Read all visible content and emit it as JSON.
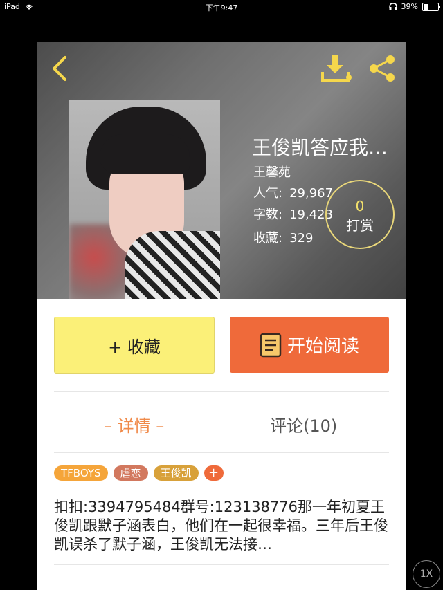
{
  "status_bar": {
    "device": "iPad",
    "time": "下午9:47",
    "battery": "39%"
  },
  "book": {
    "title": "王俊凯答应我…",
    "author": "王馨苑",
    "stats": [
      {
        "label": "人气:",
        "value": "29,967"
      },
      {
        "label": "字数:",
        "value": "19,423"
      },
      {
        "label": "收藏:",
        "value": "329"
      }
    ],
    "tip": {
      "count": "0",
      "label": "打赏"
    }
  },
  "buttons": {
    "favorite": "+ 收藏",
    "read": "开始阅读"
  },
  "tabs": {
    "details": "– 详情 –",
    "comments": "评论(10)"
  },
  "tags": [
    "TFBOYS",
    "虐恋",
    "王俊凯",
    "+"
  ],
  "description": "扣扣:3394795484群号:123138776那一年初夏王俊凯跟默子涵表白，他们在一起很幸福。三年后王俊凯误杀了默子涵，王俊凯无法接…",
  "speed": "1X",
  "icons": {
    "back": "back-arrow-icon",
    "download": "download-icon",
    "share": "share-icon",
    "book": "book-icon",
    "wifi": "wifi-icon",
    "headphones": "headphones-icon",
    "battery": "battery-icon"
  },
  "colors": {
    "accent_yellow": "#f2e06c",
    "favorite_bg": "#fbf078",
    "read_bg": "#ef6a3a",
    "active_tab": "#f08a4a"
  }
}
